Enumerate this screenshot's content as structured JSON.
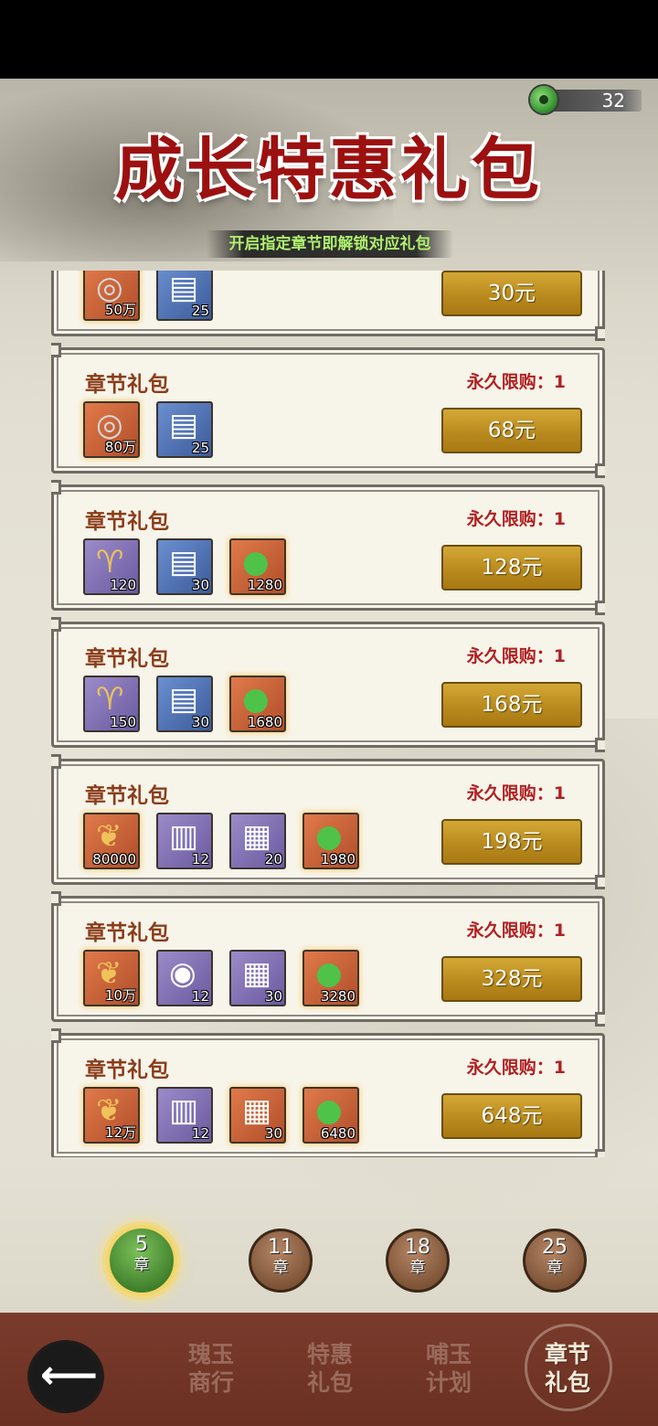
{
  "currency": {
    "icon": "jade-icon",
    "amount": "32"
  },
  "banner": {
    "title": "成长特惠礼包",
    "subtitle": "开启指定章节即解锁对应礼包"
  },
  "packs": [
    {
      "name": "",
      "limit": "",
      "price": "30元",
      "items": [
        {
          "icon": "copper-coin-icon",
          "quality": "orange",
          "count": "50万"
        },
        {
          "icon": "skill-book-icon",
          "quality": "blue",
          "count": "25"
        }
      ]
    },
    {
      "name": "章节礼包",
      "limit": "永久限购：1",
      "price": "68元",
      "items": [
        {
          "icon": "copper-coin-icon",
          "quality": "orange",
          "count": "80万"
        },
        {
          "icon": "skill-book-icon",
          "quality": "blue",
          "count": "25"
        }
      ]
    },
    {
      "name": "章节礼包",
      "limit": "永久限购：1",
      "price": "128元",
      "items": [
        {
          "icon": "horn-icon",
          "quality": "purple",
          "count": "120"
        },
        {
          "icon": "skill-book-icon",
          "quality": "blue",
          "count": "30"
        },
        {
          "icon": "jade-icon",
          "quality": "orange",
          "count": "1280"
        }
      ]
    },
    {
      "name": "章节礼包",
      "limit": "永久限购：1",
      "price": "168元",
      "items": [
        {
          "icon": "horn-icon",
          "quality": "purple",
          "count": "150"
        },
        {
          "icon": "skill-book-icon",
          "quality": "blue",
          "count": "30"
        },
        {
          "icon": "jade-icon",
          "quality": "orange",
          "count": "1680"
        }
      ]
    },
    {
      "name": "章节礼包",
      "limit": "永久限购：1",
      "price": "198元",
      "items": [
        {
          "icon": "grain-icon",
          "quality": "orange",
          "count": "80000"
        },
        {
          "icon": "speedup-card-icon",
          "quality": "purple",
          "count": "12"
        },
        {
          "icon": "scroll-icon",
          "quality": "purple",
          "count": "20"
        },
        {
          "icon": "jade-icon",
          "quality": "orange",
          "count": "1980"
        }
      ]
    },
    {
      "name": "章节礼包",
      "limit": "永久限购：1",
      "price": "328元",
      "items": [
        {
          "icon": "grain-icon",
          "quality": "orange",
          "count": "10万"
        },
        {
          "icon": "speedup-token-icon",
          "quality": "purple",
          "count": "12"
        },
        {
          "icon": "scroll-icon",
          "quality": "purple",
          "count": "30"
        },
        {
          "icon": "jade-icon",
          "quality": "orange",
          "count": "3280"
        }
      ]
    },
    {
      "name": "章节礼包",
      "limit": "永久限购：1",
      "price": "648元",
      "items": [
        {
          "icon": "grain-icon",
          "quality": "orange",
          "count": "12万"
        },
        {
          "icon": "speedup-card-icon",
          "quality": "purple",
          "count": "12"
        },
        {
          "icon": "scroll-icon",
          "quality": "orange",
          "count": "30"
        },
        {
          "icon": "jade-icon",
          "quality": "orange",
          "count": "6480"
        }
      ]
    }
  ],
  "chapters": [
    {
      "num": "5",
      "unit": "章",
      "active": true
    },
    {
      "num": "11",
      "unit": "章",
      "active": false
    },
    {
      "num": "18",
      "unit": "章",
      "active": false
    },
    {
      "num": "25",
      "unit": "章",
      "active": false
    }
  ],
  "nav": {
    "back_icon": "back-arrow-icon",
    "items": [
      {
        "line1": "瑰玉",
        "line2": "商行",
        "active": false
      },
      {
        "line1": "特惠",
        "line2": "礼包",
        "active": false
      },
      {
        "line1": "哺玉",
        "line2": "计划",
        "active": false
      },
      {
        "line1": "章节",
        "line2": "礼包",
        "active": true
      }
    ]
  },
  "colors": {
    "accent_red": "#b02121",
    "title_red": "#9c1010",
    "gold_button": "#c49a2a",
    "nav_bg": "#72352a",
    "active_chapter": "#4f9a38"
  }
}
